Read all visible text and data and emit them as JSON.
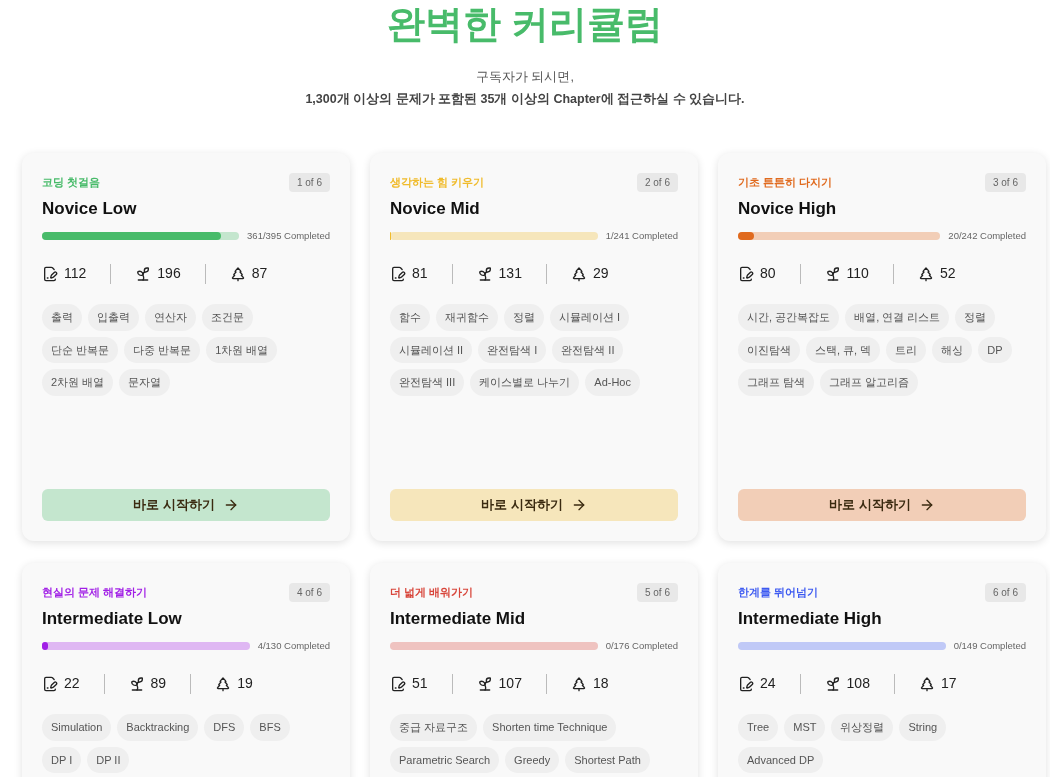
{
  "heading": "완벽한 커리큘럼",
  "subtitle": [
    "구독자가 되시면,",
    "1,300개 이상의 문제가 포함된 35개 이상의 Chapter에 접근하실 수 있습니다."
  ],
  "cards": [
    {
      "label": "코딩 첫걸음",
      "color": "#48bb6a",
      "badge": "1 of 6",
      "title": "Novice Low",
      "level": 0.91,
      "progress": "361/395 Completed",
      "stats": [
        "112",
        "196",
        "87"
      ],
      "tags": [
        "출력",
        "입출력",
        "연산자",
        "조건문",
        "단순 반복문",
        "다중 반복문",
        "1차원 배열",
        "2차원 배열",
        "문자열"
      ],
      "button": "바로 시작하기"
    },
    {
      "label": "생각하는 힘 키우기",
      "color": "#f0bb2c",
      "badge": "2 of 6",
      "title": "Novice Mid",
      "level": 0.004,
      "progress": "1/241 Completed",
      "stats": [
        "81",
        "131",
        "29"
      ],
      "tags": [
        "함수",
        "재귀함수",
        "정렬",
        "시뮬레이션 I",
        "시뮬레이션 II",
        "완전탐색 I",
        "완전탐색 II",
        "완전탐색 III",
        "케이스별로 나누기",
        "Ad-Hoc"
      ],
      "button": "바로 시작하기"
    },
    {
      "label": "기초 튼튼히 다지기",
      "color": "#e06a1e",
      "badge": "3 of 6",
      "title": "Novice High",
      "level": 0.08,
      "progress": "20/242 Completed",
      "stats": [
        "80",
        "110",
        "52"
      ],
      "tags": [
        "시간, 공간복잡도",
        "배열, 연결 리스트",
        "정렬",
        "이진탐색",
        "스택, 큐, 덱",
        "트리",
        "해싱",
        "DP",
        "그래프 탐색",
        "그래프 알고리즘"
      ],
      "button": "바로 시작하기"
    },
    {
      "label": "현실의 문제 해결하기",
      "color": "#a11fe6",
      "badge": "4 of 6",
      "title": "Intermediate Low",
      "level": 0.03,
      "progress": "4/130 Completed",
      "stats": [
        "22",
        "89",
        "19"
      ],
      "tags": [
        "Simulation",
        "Backtracking",
        "DFS",
        "BFS",
        "DP I",
        "DP II"
      ]
    },
    {
      "label": "더 넓게 배워가기",
      "color": "#d8453a",
      "badge": "5 of 6",
      "title": "Intermediate Mid",
      "level": 0,
      "progress": "0/176 Completed",
      "stats": [
        "51",
        "107",
        "18"
      ],
      "tags": [
        "중급 자료구조",
        "Shorten time Technique",
        "Parametric Search",
        "Greedy",
        "Shortest Path"
      ]
    },
    {
      "label": "한계를 뛰어넘기",
      "color": "#3d5af1",
      "badge": "6 of 6",
      "title": "Intermediate High",
      "level": 0,
      "progress": "0/149 Completed",
      "stats": [
        "24",
        "108",
        "17"
      ],
      "tags": [
        "Tree",
        "MST",
        "위상정렬",
        "String",
        "Advanced DP"
      ]
    }
  ]
}
